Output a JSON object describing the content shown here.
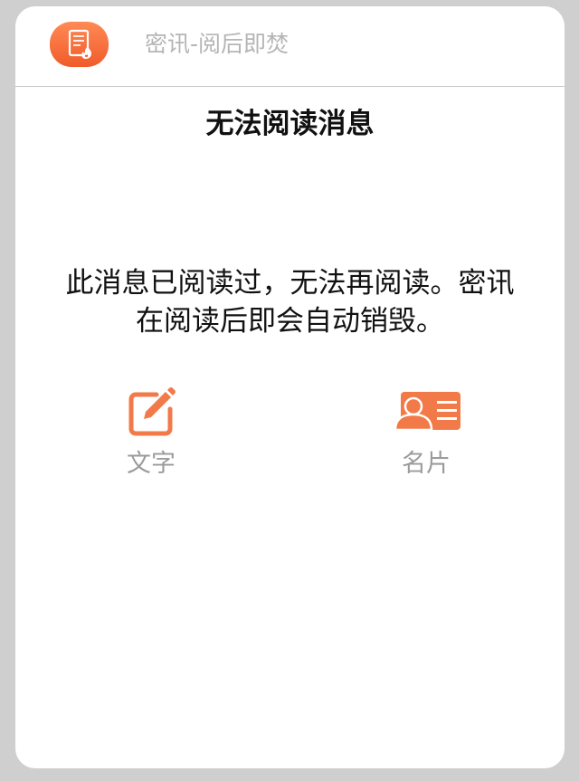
{
  "header": {
    "app_icon": "document-fire-icon",
    "title": "密讯-阅后即焚"
  },
  "dialog": {
    "title": "无法阅读消息",
    "message_line1": "此消息已阅读过，无法再阅读。密讯",
    "message_line2": "在阅读后即会自动销毁。"
  },
  "options": [
    {
      "label": "文字",
      "icon": "edit-pencil-icon"
    },
    {
      "label": "名片",
      "icon": "contact-card-icon"
    }
  ],
  "colors": {
    "accent": "#f27a48",
    "label_gray": "#9b9b9b",
    "title_gray": "#b5b5b5",
    "background": "#cfcfcf"
  }
}
